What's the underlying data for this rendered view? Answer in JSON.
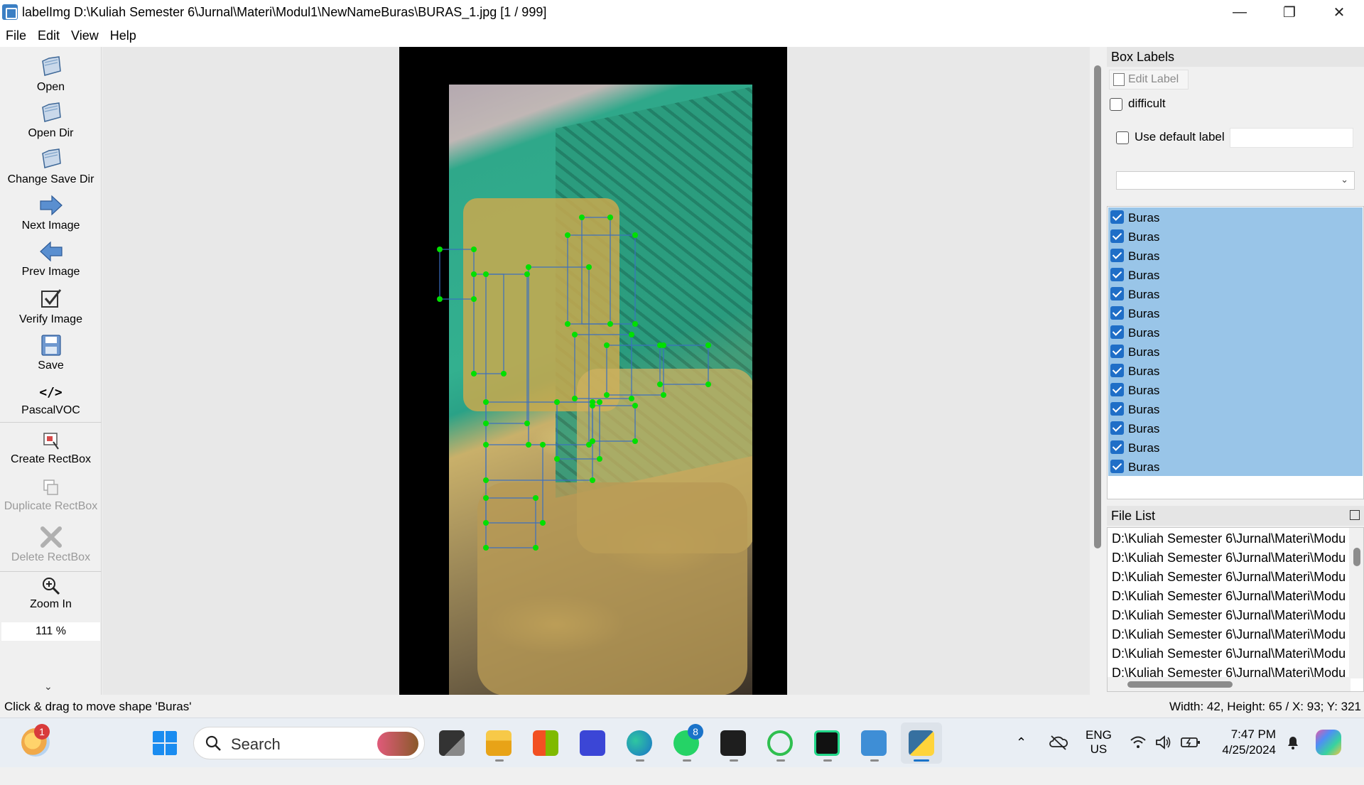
{
  "window": {
    "title": "labelImg D:\\Kuliah Semester 6\\Jurnal\\Materi\\Modul1\\NewNameBuras\\BURAS_1.jpg [1 / 999]"
  },
  "menu": [
    "File",
    "Edit",
    "View",
    "Help"
  ],
  "toolbar": {
    "open": "Open",
    "open_dir": "Open Dir",
    "change_save_dir": "Change Save Dir",
    "next_image": "Next Image",
    "prev_image": "Prev Image",
    "verify_image": "Verify Image",
    "save": "Save",
    "format_glyph": "</>",
    "format": "PascalVOC",
    "create_rectbox": "Create RectBox",
    "duplicate_rectbox": "Duplicate RectBox",
    "delete_rectbox": "Delete RectBox",
    "zoom_in": "Zoom In",
    "zoom_value": "111 %",
    "more_glyph": "⌄"
  },
  "box_labels": {
    "title": "Box Labels",
    "edit_label": "Edit Label",
    "difficult": "difficult",
    "use_default_label": "Use default label",
    "default_label_value": "",
    "combo_value": "",
    "labels": [
      "Buras",
      "Buras",
      "Buras",
      "Buras",
      "Buras",
      "Buras",
      "Buras",
      "Buras",
      "Buras",
      "Buras",
      "Buras",
      "Buras",
      "Buras",
      "Buras"
    ]
  },
  "file_list": {
    "title": "File List",
    "items": [
      "D:\\Kuliah Semester 6\\Jurnal\\Materi\\Modu",
      "D:\\Kuliah Semester 6\\Jurnal\\Materi\\Modu",
      "D:\\Kuliah Semester 6\\Jurnal\\Materi\\Modu",
      "D:\\Kuliah Semester 6\\Jurnal\\Materi\\Modu",
      "D:\\Kuliah Semester 6\\Jurnal\\Materi\\Modu",
      "D:\\Kuliah Semester 6\\Jurnal\\Materi\\Modu",
      "D:\\Kuliah Semester 6\\Jurnal\\Materi\\Modu",
      "D:\\Kuliah Semester 6\\Jurnal\\Materi\\Modu"
    ]
  },
  "status": {
    "message": "Click & drag to move shape 'Buras'",
    "info": "Width: 42, Height: 65 / X: 93; Y: 321"
  },
  "taskbar": {
    "search_placeholder": "Search",
    "weather_badge": "1",
    "whatsapp_badge": "8",
    "lang_top": "ENG",
    "lang_bottom": "US",
    "time": "7:47 PM",
    "date": "4/25/2024"
  },
  "colors": {
    "label_selection": "#99c5e8",
    "checkbox": "#1f6ec7",
    "vertex": "#00e000",
    "box_line": "#3a6fc0"
  }
}
